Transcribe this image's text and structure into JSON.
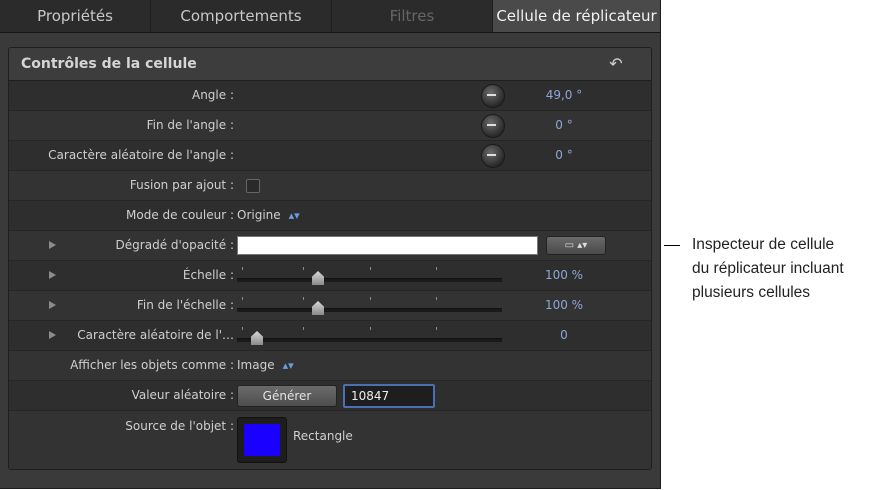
{
  "tabs": [
    {
      "label": "Propriétés",
      "state": "normal"
    },
    {
      "label": "Comportements",
      "state": "normal"
    },
    {
      "label": "Filtres",
      "state": "disabled"
    },
    {
      "label": "Cellule de réplicateur",
      "state": "active"
    }
  ],
  "group": {
    "title": "Contrôles de la cellule",
    "reset_icon": "undo-arrow-icon"
  },
  "rows": {
    "angle": {
      "label": "Angle :",
      "value": "49,0 °"
    },
    "end_angle": {
      "label": "Fin de l'angle :",
      "value": "0 °"
    },
    "angle_randomness": {
      "label": "Caractère aléatoire de l'angle :",
      "value": "0 °"
    },
    "additive_blend": {
      "label": "Fusion par ajout :",
      "checked": false
    },
    "color_mode": {
      "label": "Mode de couleur :",
      "value": "Origine"
    },
    "opacity_gradient": {
      "label": "Dégradé d'opacité :",
      "gradient_color": "#ffffff",
      "menu_icon": "gradient-preset-icon"
    },
    "scale": {
      "label": "Échelle :",
      "value": "100 %",
      "level": 0.25
    },
    "end_scale": {
      "label": "Fin de l'échelle :",
      "value": "100 %",
      "level": 0.25
    },
    "scale_randomness": {
      "label": "Caractère aléatoire de l'…",
      "value": "0",
      "level": 0.02
    },
    "show_objects_as": {
      "label": "Afficher les objets comme :",
      "value": "Image"
    },
    "random_seed": {
      "label": "Valeur aléatoire :",
      "button": "Générer",
      "value": "10847"
    },
    "object_source": {
      "label": "Source de l'objet :",
      "source_name": "Rectangle",
      "swatch_color": "#1a00ff"
    }
  },
  "callout": {
    "line1": "Inspecteur de cellule",
    "line2": "du réplicateur incluant",
    "line3": "plusieurs cellules"
  }
}
